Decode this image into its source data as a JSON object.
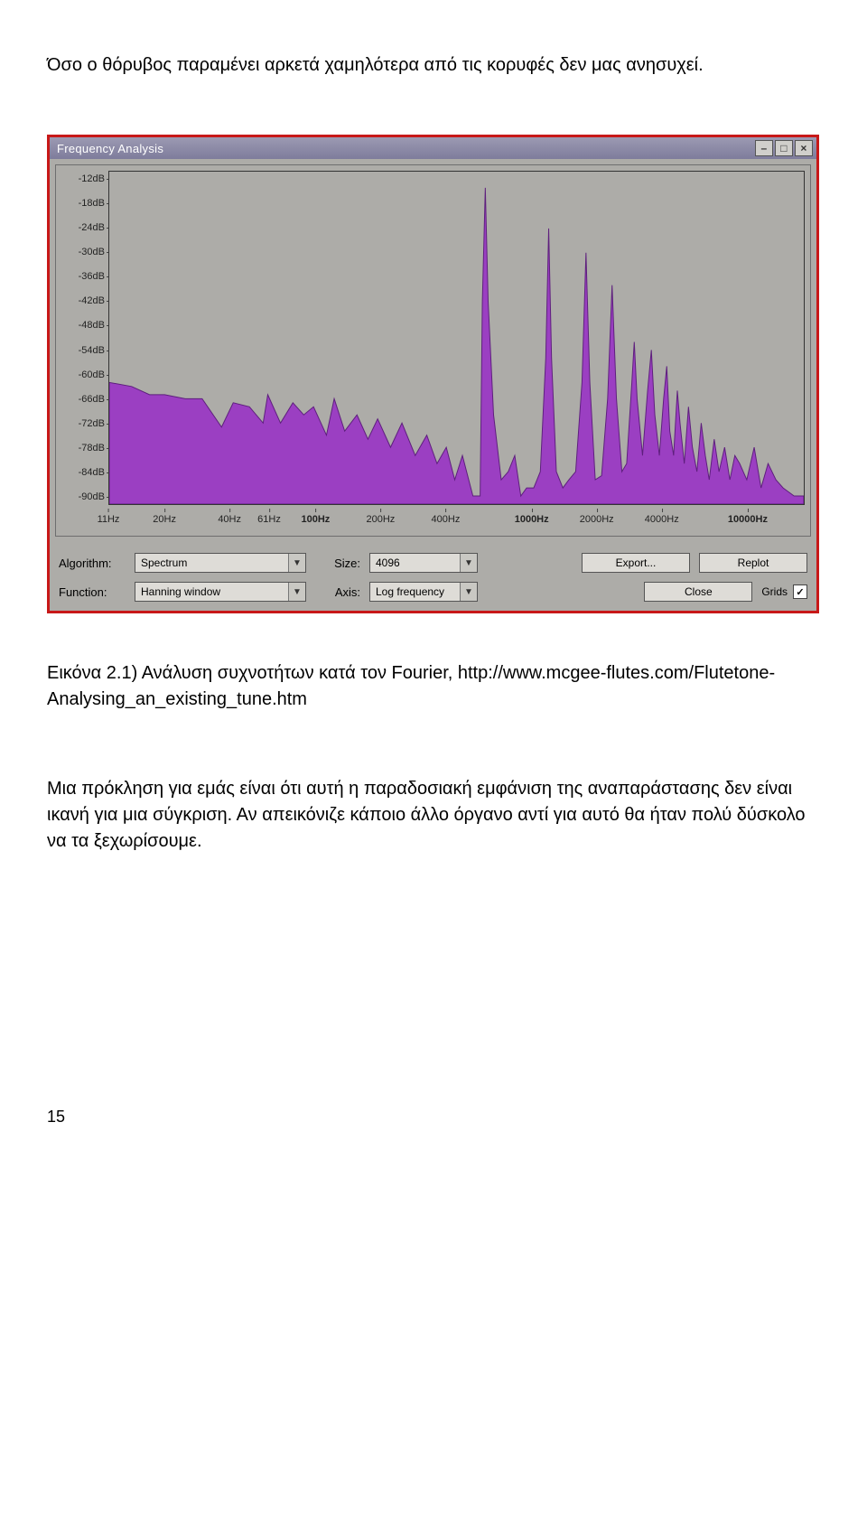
{
  "intro": "Όσο ο θόρυβος παραμένει αρκετά χαμηλότερα από τις κορυφές δεν μας ανησυχεί.",
  "caption": "Εικόνα 2.1) Ανάλυση συχνοτήτων κατά τον Fourier, http://www.mcgee-flutes.com/Flutetone-Analysing_an_existing_tune.htm",
  "challenge": "Μια πρόκληση για εμάς είναι ότι αυτή η παραδοσιακή εμφάνιση της αναπαράστασης δεν είναι ικανή για μια σύγκριση. Αν απεικόνιζε κάποιο άλλο όργανο αντί για αυτό θα ήταν πολύ δύσκολο να τα ξεχωρίσουμε.",
  "pagenum": "15",
  "window": {
    "title": "Frequency Analysis"
  },
  "controls": {
    "algorithm_label": "Algorithm:",
    "algorithm_value": "Spectrum",
    "size_label": "Size:",
    "size_value": "4096",
    "function_label": "Function:",
    "function_value": "Hanning window",
    "axis_label": "Axis:",
    "axis_value": "Log frequency",
    "export": "Export...",
    "replot": "Replot",
    "close": "Close",
    "grids": "Grids",
    "grids_checked": "✓"
  },
  "chart_data": {
    "type": "area",
    "title": "",
    "xlabel": "",
    "ylabel": "",
    "x_scale": "log",
    "xlim": [
      11,
      20000
    ],
    "y_ticks_db": [
      -12,
      -18,
      -24,
      -30,
      -36,
      -42,
      -48,
      -54,
      -60,
      -66,
      -72,
      -78,
      -84,
      -90
    ],
    "x_ticks": [
      {
        "label": "11Hz",
        "value": 11,
        "bold": false
      },
      {
        "label": "20Hz",
        "value": 20,
        "bold": false
      },
      {
        "label": "40Hz",
        "value": 40,
        "bold": false
      },
      {
        "label": "61Hz",
        "value": 61,
        "bold": false
      },
      {
        "label": "100Hz",
        "value": 100,
        "bold": true
      },
      {
        "label": "200Hz",
        "value": 200,
        "bold": false
      },
      {
        "label": "400Hz",
        "value": 400,
        "bold": false
      },
      {
        "label": "1000Hz",
        "value": 1000,
        "bold": true
      },
      {
        "label": "2000Hz",
        "value": 2000,
        "bold": false
      },
      {
        "label": "4000Hz",
        "value": 4000,
        "bold": false
      },
      {
        "label": "10000Hz",
        "value": 10000,
        "bold": true
      }
    ],
    "series": [
      {
        "name": "spectrum",
        "points": [
          {
            "hz": 11,
            "db": -62
          },
          {
            "hz": 14,
            "db": -63
          },
          {
            "hz": 17,
            "db": -65
          },
          {
            "hz": 20,
            "db": -65
          },
          {
            "hz": 25,
            "db": -66
          },
          {
            "hz": 30,
            "db": -66
          },
          {
            "hz": 37,
            "db": -73
          },
          {
            "hz": 42,
            "db": -67
          },
          {
            "hz": 50,
            "db": -68
          },
          {
            "hz": 58,
            "db": -72
          },
          {
            "hz": 61,
            "db": -65
          },
          {
            "hz": 70,
            "db": -72
          },
          {
            "hz": 80,
            "db": -67
          },
          {
            "hz": 90,
            "db": -70
          },
          {
            "hz": 100,
            "db": -68
          },
          {
            "hz": 115,
            "db": -75
          },
          {
            "hz": 125,
            "db": -66
          },
          {
            "hz": 140,
            "db": -74
          },
          {
            "hz": 160,
            "db": -70
          },
          {
            "hz": 180,
            "db": -76
          },
          {
            "hz": 200,
            "db": -71
          },
          {
            "hz": 230,
            "db": -78
          },
          {
            "hz": 260,
            "db": -72
          },
          {
            "hz": 300,
            "db": -80
          },
          {
            "hz": 340,
            "db": -75
          },
          {
            "hz": 380,
            "db": -82
          },
          {
            "hz": 420,
            "db": -78
          },
          {
            "hz": 460,
            "db": -86
          },
          {
            "hz": 500,
            "db": -80
          },
          {
            "hz": 560,
            "db": -90
          },
          {
            "hz": 605,
            "db": -90
          },
          {
            "hz": 620,
            "db": -42
          },
          {
            "hz": 640,
            "db": -14
          },
          {
            "hz": 660,
            "db": -42
          },
          {
            "hz": 700,
            "db": -70
          },
          {
            "hz": 760,
            "db": -86
          },
          {
            "hz": 820,
            "db": -84
          },
          {
            "hz": 880,
            "db": -80
          },
          {
            "hz": 940,
            "db": -90
          },
          {
            "hz": 1000,
            "db": -88
          },
          {
            "hz": 1080,
            "db": -88
          },
          {
            "hz": 1160,
            "db": -84
          },
          {
            "hz": 1230,
            "db": -56
          },
          {
            "hz": 1270,
            "db": -24
          },
          {
            "hz": 1310,
            "db": -56
          },
          {
            "hz": 1380,
            "db": -84
          },
          {
            "hz": 1480,
            "db": -88
          },
          {
            "hz": 1580,
            "db": -86
          },
          {
            "hz": 1700,
            "db": -84
          },
          {
            "hz": 1820,
            "db": -62
          },
          {
            "hz": 1900,
            "db": -30
          },
          {
            "hz": 1980,
            "db": -62
          },
          {
            "hz": 2100,
            "db": -86
          },
          {
            "hz": 2250,
            "db": -85
          },
          {
            "hz": 2400,
            "db": -66
          },
          {
            "hz": 2520,
            "db": -38
          },
          {
            "hz": 2640,
            "db": -66
          },
          {
            "hz": 2800,
            "db": -84
          },
          {
            "hz": 2950,
            "db": -82
          },
          {
            "hz": 3120,
            "db": -62
          },
          {
            "hz": 3200,
            "db": -52
          },
          {
            "hz": 3300,
            "db": -66
          },
          {
            "hz": 3500,
            "db": -80
          },
          {
            "hz": 3700,
            "db": -64
          },
          {
            "hz": 3850,
            "db": -54
          },
          {
            "hz": 4000,
            "db": -70
          },
          {
            "hz": 4200,
            "db": -80
          },
          {
            "hz": 4400,
            "db": -66
          },
          {
            "hz": 4550,
            "db": -58
          },
          {
            "hz": 4700,
            "db": -74
          },
          {
            "hz": 4900,
            "db": -80
          },
          {
            "hz": 5100,
            "db": -64
          },
          {
            "hz": 5250,
            "db": -72
          },
          {
            "hz": 5500,
            "db": -82
          },
          {
            "hz": 5750,
            "db": -68
          },
          {
            "hz": 6000,
            "db": -78
          },
          {
            "hz": 6300,
            "db": -84
          },
          {
            "hz": 6600,
            "db": -72
          },
          {
            "hz": 6900,
            "db": -80
          },
          {
            "hz": 7200,
            "db": -86
          },
          {
            "hz": 7600,
            "db": -76
          },
          {
            "hz": 8000,
            "db": -84
          },
          {
            "hz": 8500,
            "db": -78
          },
          {
            "hz": 9000,
            "db": -86
          },
          {
            "hz": 9500,
            "db": -80
          },
          {
            "hz": 10000,
            "db": -82
          },
          {
            "hz": 10800,
            "db": -86
          },
          {
            "hz": 11700,
            "db": -78
          },
          {
            "hz": 12600,
            "db": -88
          },
          {
            "hz": 13600,
            "db": -82
          },
          {
            "hz": 14800,
            "db": -86
          },
          {
            "hz": 16000,
            "db": -88
          },
          {
            "hz": 18000,
            "db": -90
          },
          {
            "hz": 20000,
            "db": -90
          }
        ]
      }
    ]
  }
}
